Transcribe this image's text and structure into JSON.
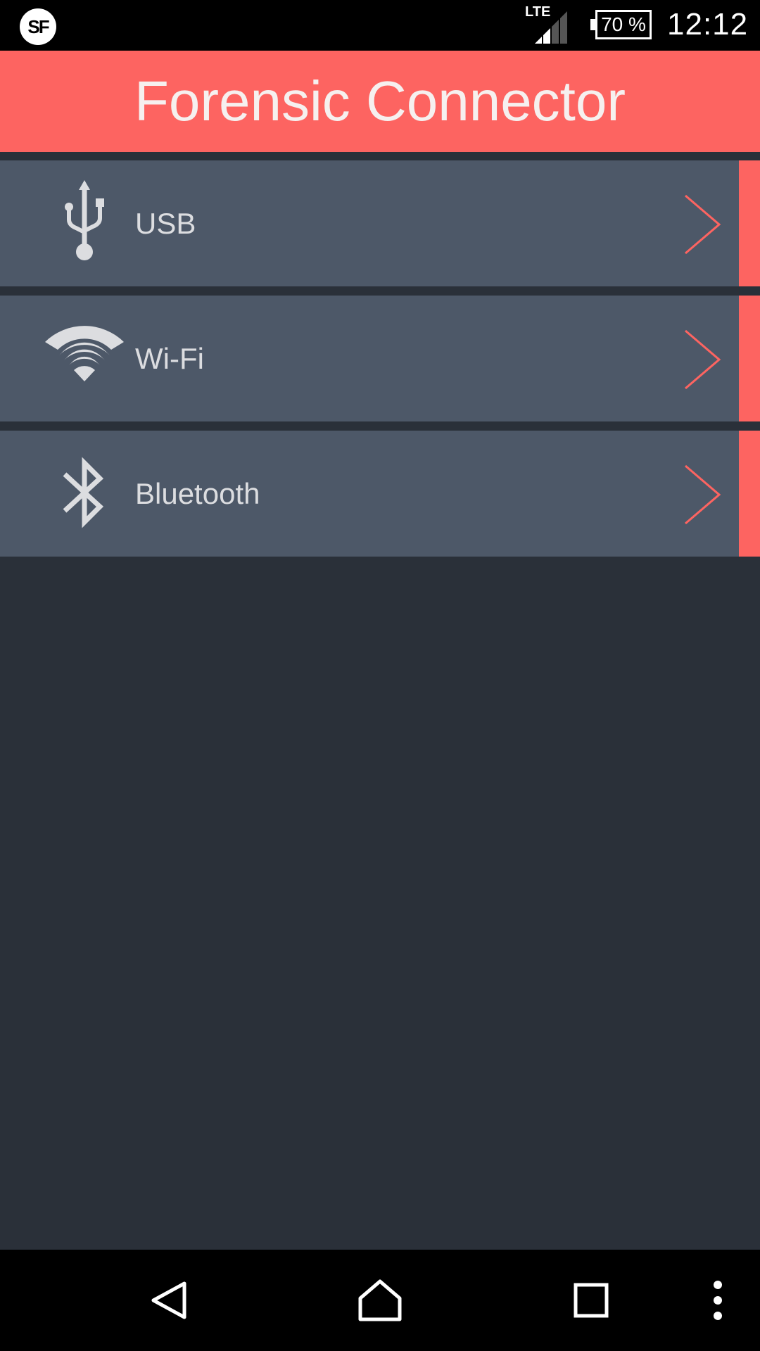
{
  "status_bar": {
    "app_icon_text": "SF",
    "network": "LTE",
    "battery": "70 %",
    "time": "12:12"
  },
  "app_bar": {
    "title": "Forensic Connector"
  },
  "connections": [
    {
      "label": "USB",
      "icon": "usb-icon"
    },
    {
      "label": "Wi-Fi",
      "icon": "wifi-icon"
    },
    {
      "label": "Bluetooth",
      "icon": "bluetooth-icon"
    }
  ],
  "nav_bar": {
    "buttons": [
      "back-icon",
      "home-icon",
      "recents-icon",
      "overflow-menu-icon"
    ]
  },
  "colors": {
    "accent": "#fd6461",
    "list_item": "#4d5868",
    "background": "#2a3039"
  }
}
